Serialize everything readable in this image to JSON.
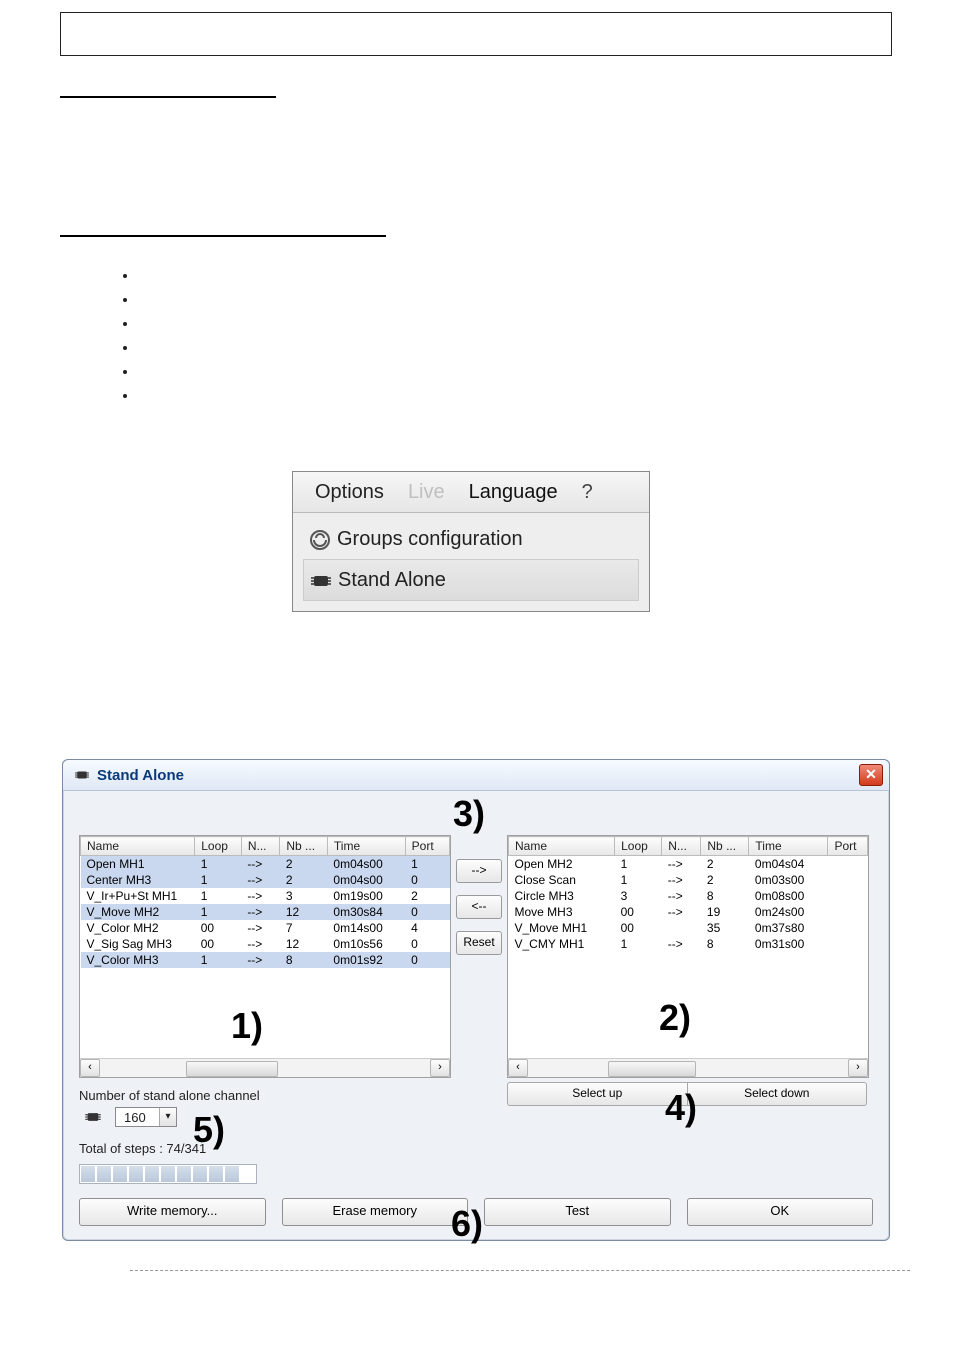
{
  "menu": {
    "items": [
      "Options",
      "Live",
      "Language",
      "?"
    ],
    "groups_label": "Groups configuration",
    "standalone_label": "Stand Alone"
  },
  "window": {
    "title": "Stand Alone"
  },
  "columns": {
    "name": "Name",
    "loop": "Loop",
    "n": "N...",
    "nb": "Nb ...",
    "time": "Time",
    "port": "Port"
  },
  "left_scenes": [
    {
      "name": "Open MH1",
      "loop": "1",
      "n": "-->",
      "nb": "2",
      "time": "0m04s00",
      "port": "1",
      "sel": true
    },
    {
      "name": "Center MH3",
      "loop": "1",
      "n": "-->",
      "nb": "2",
      "time": "0m04s00",
      "port": "0",
      "sel": true
    },
    {
      "name": "V_Ir+Pu+St MH1",
      "loop": "1",
      "n": "-->",
      "nb": "3",
      "time": "0m19s00",
      "port": "2",
      "sel": false
    },
    {
      "name": "V_Move MH2",
      "loop": "1",
      "n": "-->",
      "nb": "12",
      "time": "0m30s84",
      "port": "0",
      "sel": true
    },
    {
      "name": "V_Color MH2",
      "loop": "00",
      "n": "-->",
      "nb": "7",
      "time": "0m14s00",
      "port": "4",
      "sel": false
    },
    {
      "name": "V_Sig Sag MH3",
      "loop": "00",
      "n": "-->",
      "nb": "12",
      "time": "0m10s56",
      "port": "0",
      "sel": false
    },
    {
      "name": "V_Color MH3",
      "loop": "1",
      "n": "-->",
      "nb": "8",
      "time": "0m01s92",
      "port": "0",
      "sel": true
    }
  ],
  "right_scenes": [
    {
      "name": "Open MH2",
      "loop": "1",
      "n": "-->",
      "nb": "2",
      "time": "0m04s04"
    },
    {
      "name": "Close Scan",
      "loop": "1",
      "n": "-->",
      "nb": "2",
      "time": "0m03s00"
    },
    {
      "name": "Circle MH3",
      "loop": "3",
      "n": "-->",
      "nb": "8",
      "time": "0m08s00"
    },
    {
      "name": "Move MH3",
      "loop": "00",
      "n": "-->",
      "nb": "19",
      "time": "0m24s00"
    },
    {
      "name": "V_Move MH1",
      "loop": "00",
      "n": "",
      "nb": "35",
      "time": "0m37s80"
    },
    {
      "name": "V_CMY MH1",
      "loop": "1",
      "n": "-->",
      "nb": "8",
      "time": "0m31s00"
    }
  ],
  "mid_buttons": {
    "move_right": "-->",
    "move_left": "<--",
    "reset": "Reset"
  },
  "labels": {
    "channels": "Number of stand alone channel",
    "channel_value": "160",
    "total_steps": "Total of steps : 74/341",
    "select_up": "Select up",
    "select_down": "Select down"
  },
  "bottom_buttons": {
    "write": "Write memory...",
    "erase": "Erase memory",
    "test": "Test",
    "ok": "OK"
  },
  "annotations": {
    "n1": "1)",
    "n2": "2)",
    "n3": "3)",
    "n4": "4)",
    "n5": "5)",
    "n6": "6)"
  }
}
